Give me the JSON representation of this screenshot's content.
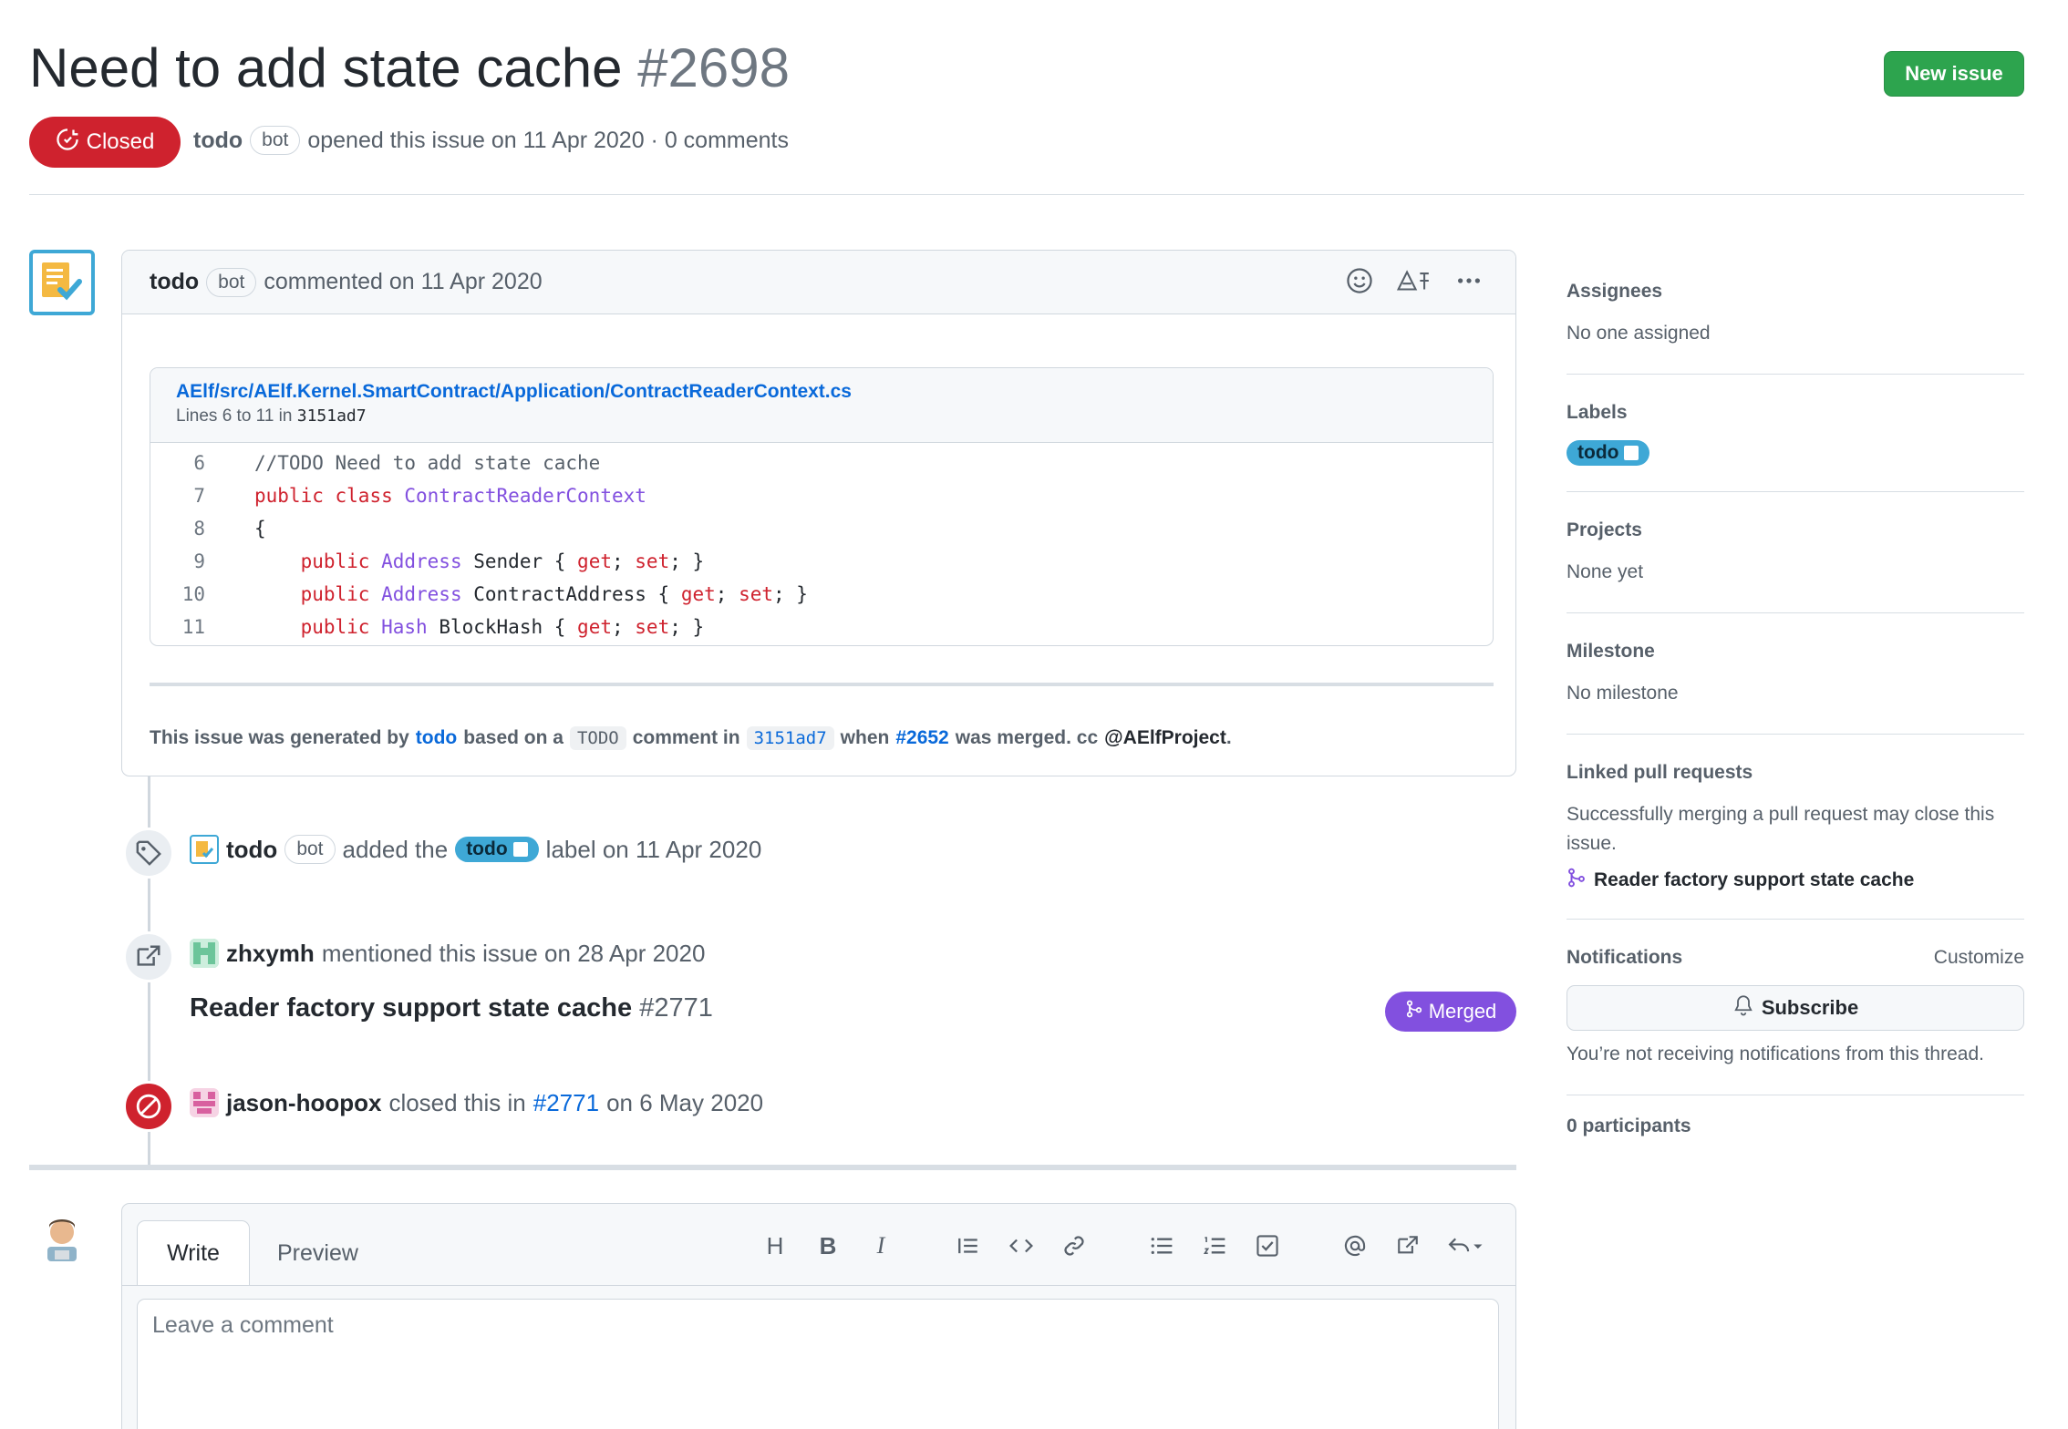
{
  "issue": {
    "title": "Need to add state cache",
    "number": "#2698",
    "state": "Closed",
    "author": "todo",
    "author_tag": "bot",
    "opened_text": "opened this issue on 11 Apr 2020 · 0 comments",
    "new_issue_label": "New issue"
  },
  "comment": {
    "author": "todo",
    "author_tag": "bot",
    "meta": "commented on 11 Apr 2020",
    "snippet": {
      "path": "AElf/src/AElf.Kernel.SmartContract/Application/ContractReaderContext.cs",
      "lines_text": "Lines 6 to 11 in",
      "commit": "3151ad7",
      "lines": [
        {
          "n": "6",
          "parts": [
            {
              "t": "//TODO Need to add state cache",
              "c": "cm"
            }
          ]
        },
        {
          "n": "7",
          "parts": [
            {
              "t": "public",
              "c": "kw"
            },
            {
              "t": " "
            },
            {
              "t": "class",
              "c": "kw"
            },
            {
              "t": " "
            },
            {
              "t": "ContractReaderContext",
              "c": "ty"
            }
          ]
        },
        {
          "n": "8",
          "parts": [
            {
              "t": "{"
            }
          ]
        },
        {
          "n": "9",
          "parts": [
            {
              "t": "    "
            },
            {
              "t": "public",
              "c": "kw"
            },
            {
              "t": " "
            },
            {
              "t": "Address",
              "c": "ty"
            },
            {
              "t": " Sender { "
            },
            {
              "t": "get",
              "c": "kw"
            },
            {
              "t": "; "
            },
            {
              "t": "set",
              "c": "kw"
            },
            {
              "t": "; }"
            }
          ]
        },
        {
          "n": "10",
          "parts": [
            {
              "t": "    "
            },
            {
              "t": "public",
              "c": "kw"
            },
            {
              "t": " "
            },
            {
              "t": "Address",
              "c": "ty"
            },
            {
              "t": " ContractAddress { "
            },
            {
              "t": "get",
              "c": "kw"
            },
            {
              "t": "; "
            },
            {
              "t": "set",
              "c": "kw"
            },
            {
              "t": "; }"
            }
          ]
        },
        {
          "n": "11",
          "parts": [
            {
              "t": "    "
            },
            {
              "t": "public",
              "c": "kw"
            },
            {
              "t": " "
            },
            {
              "t": "Hash",
              "c": "ty"
            },
            {
              "t": " BlockHash { "
            },
            {
              "t": "get",
              "c": "kw"
            },
            {
              "t": "; "
            },
            {
              "t": "set",
              "c": "kw"
            },
            {
              "t": "; }"
            }
          ]
        }
      ]
    },
    "footnote": {
      "p1": "This issue was generated by",
      "link1": "todo",
      "p2": "based on a",
      "code": "TODO",
      "p3": "comment in",
      "commit": "3151ad7",
      "p4": "when",
      "pr": "#2652",
      "p5": "was merged. cc",
      "mention": "@AElfProject",
      "p6": "."
    }
  },
  "timeline": {
    "label_event": {
      "actor": "todo",
      "actor_tag": "bot",
      "p1": "added the",
      "label": "todo",
      "p2": "label on 11 Apr 2020"
    },
    "mention_event": {
      "actor": "zhxymh",
      "text": "mentioned this issue on 28 Apr 2020",
      "pr_title": "Reader factory support state cache",
      "pr_number": "#2771",
      "pr_state": "Merged"
    },
    "close_event": {
      "actor": "jason-hoopox",
      "p1": "closed this in",
      "pr": "#2771",
      "p2": "on 6 May 2020"
    }
  },
  "composer": {
    "tab_write": "Write",
    "tab_preview": "Preview",
    "placeholder": "Leave a comment",
    "toolbar": [
      "H",
      "B",
      "I"
    ]
  },
  "sidebar": {
    "assignees": {
      "title": "Assignees",
      "value": "No one assigned"
    },
    "labels": {
      "title": "Labels",
      "label": "todo"
    },
    "projects": {
      "title": "Projects",
      "value": "None yet"
    },
    "milestone": {
      "title": "Milestone",
      "value": "No milestone"
    },
    "linked_prs": {
      "title": "Linked pull requests",
      "value": "Successfully merging a pull request may close this issue.",
      "pr": "Reader factory support state cache"
    },
    "notifications": {
      "title": "Notifications",
      "customize": "Customize",
      "subscribe": "Subscribe",
      "value": "You’re not receiving notifications from this thread."
    },
    "participants": "0 participants"
  },
  "colors": {
    "closed": "#cf222e",
    "merged": "#8250df",
    "new_issue": "#2da44e",
    "link": "#0969da",
    "label": "#3ea8d6"
  }
}
